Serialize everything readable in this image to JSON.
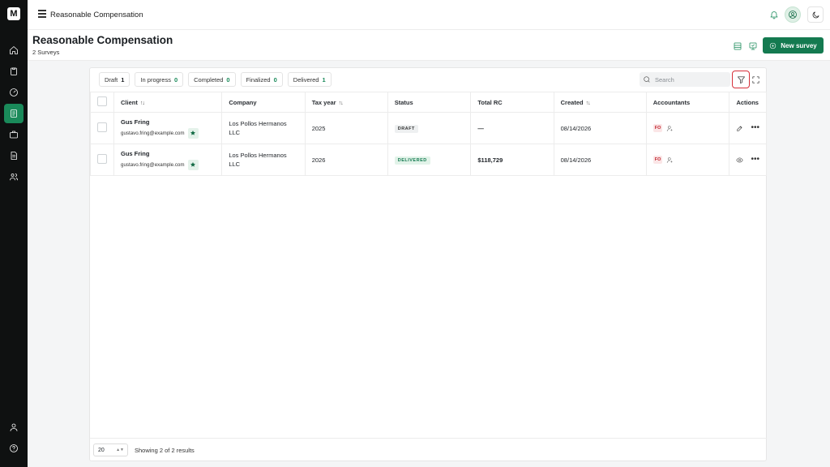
{
  "app": {
    "logo_text": "M"
  },
  "topbar": {
    "breadcrumb": "Reasonable Compensation"
  },
  "header": {
    "title": "Reasonable Compensation",
    "subtitle": "2 Surveys",
    "new_button": "New survey"
  },
  "tabs": [
    {
      "label": "Draft",
      "count": "1"
    },
    {
      "label": "In progress",
      "count": "0"
    },
    {
      "label": "Completed",
      "count": "0"
    },
    {
      "label": "Finalized",
      "count": "0"
    },
    {
      "label": "Delivered",
      "count": "1"
    }
  ],
  "search": {
    "placeholder": "Search"
  },
  "table": {
    "columns": [
      "Client",
      "Company",
      "Tax year",
      "Status",
      "Total RC",
      "Created",
      "Accountants",
      "Actions"
    ],
    "rows": [
      {
        "client_name": "Gus Fring",
        "client_email": "gustavo.fring@example.com",
        "company_line1": "Los Pollos Hermanos",
        "company_line2": "LLC",
        "tax_year": "2025",
        "status": "DRAFT",
        "total_rc": "—",
        "created": "08/14/2026",
        "accountant": "FO"
      },
      {
        "client_name": "Gus Fring",
        "client_email": "gustavo.fring@example.com",
        "company_line1": "Los Pollos Hermanos",
        "company_line2": "LLC",
        "tax_year": "2026",
        "status": "DELIVERED",
        "total_rc": "$118,729",
        "created": "08/14/2026",
        "accountant": "FO"
      }
    ]
  },
  "footer": {
    "page_size": "20",
    "showing": "Showing 2 of 2 results"
  },
  "colors": {
    "accent": "#147a50",
    "rail": "#0f1111",
    "filter_highlight": "#d6303a"
  }
}
